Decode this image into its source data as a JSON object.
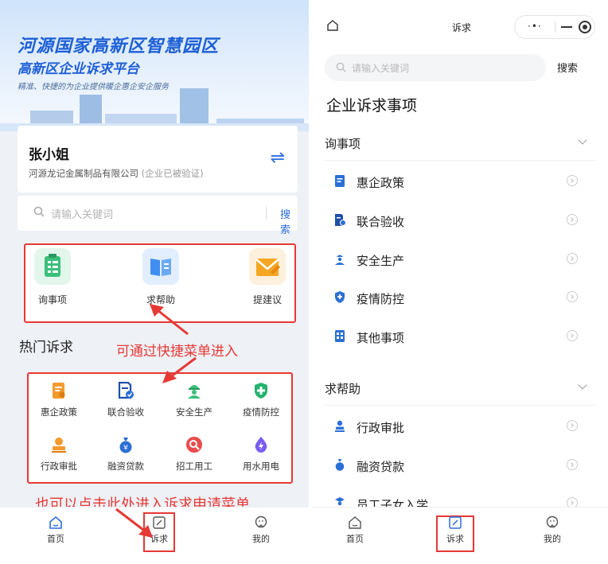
{
  "left": {
    "banner": {
      "title": "河源国家高新区智慧园区",
      "subtitle": "高新区企业诉求平台",
      "tagline": "精准、快捷的为企业提供暖企惠企安企服务"
    },
    "user": {
      "name": "张小姐",
      "company": "河源龙记金属制品有限公司",
      "verified": "(企业已被验证)",
      "switch_icon": "swap-icon"
    },
    "search": {
      "placeholder": "请输入关键词",
      "button": "搜索"
    },
    "quick_menu": [
      {
        "label": "询事项",
        "icon": "checklist-icon",
        "color": "#3bbf7a"
      },
      {
        "label": "求帮助",
        "icon": "book-icon",
        "color": "#3f8ef0"
      },
      {
        "label": "提建议",
        "icon": "mail-icon",
        "color": "#f5a623"
      }
    ],
    "hot_title": "热门诉求",
    "hot_items": [
      {
        "label": "惠企政策",
        "icon": "policy-icon",
        "color": "#f29a2e"
      },
      {
        "label": "联合验收",
        "icon": "document-check-icon",
        "color": "#1d4fa8"
      },
      {
        "label": "安全生产",
        "icon": "worker-icon",
        "color": "#3bbf7a"
      },
      {
        "label": "疫情防控",
        "icon": "shield-plus-icon",
        "color": "#23b26d"
      },
      {
        "label": "行政审批",
        "icon": "approval-icon",
        "color": "#f29a2e"
      },
      {
        "label": "融资贷款",
        "icon": "money-bag-icon",
        "color": "#2b6fd6"
      },
      {
        "label": "招工用工",
        "icon": "recruit-icon",
        "color": "#e84c4c"
      },
      {
        "label": "用水用电",
        "icon": "drop-bolt-icon",
        "color": "#7a5cf0"
      }
    ],
    "annotation_1": "可通过快捷菜单进入",
    "annotation_2": "也可以点击此处进入诉求申请菜单",
    "tabs": [
      {
        "label": "首页",
        "icon": "home-icon"
      },
      {
        "label": "诉求",
        "icon": "edit-icon"
      },
      {
        "label": "我的",
        "icon": "user-icon"
      }
    ]
  },
  "right": {
    "nav_title": "诉求",
    "search": {
      "placeholder": "请输入关键词",
      "button": "搜索"
    },
    "section_title": "企业诉求事项",
    "categories": [
      {
        "title": "询事项",
        "items": [
          {
            "label": "惠企政策",
            "icon": "policy-icon",
            "color": "#2b6fd6"
          },
          {
            "label": "联合验收",
            "icon": "document-check-icon",
            "color": "#1d4fa8"
          },
          {
            "label": "安全生产",
            "icon": "worker-icon",
            "color": "#2b6fd6"
          },
          {
            "label": "疫情防控",
            "icon": "shield-plus-icon",
            "color": "#2b6fd6"
          },
          {
            "label": "其他事项",
            "icon": "grid-doc-icon",
            "color": "#2b6fd6"
          }
        ]
      },
      {
        "title": "求帮助",
        "items": [
          {
            "label": "行政审批",
            "icon": "approval-icon",
            "color": "#2b6fd6"
          },
          {
            "label": "融资贷款",
            "icon": "money-bag-icon",
            "color": "#2b6fd6"
          },
          {
            "label": "员工子女入学",
            "icon": "student-icon",
            "color": "#2b6fd6"
          }
        ]
      }
    ],
    "tabs": [
      {
        "label": "首页",
        "icon": "home-icon"
      },
      {
        "label": "诉求",
        "icon": "edit-icon"
      },
      {
        "label": "我的",
        "icon": "user-icon"
      }
    ]
  }
}
